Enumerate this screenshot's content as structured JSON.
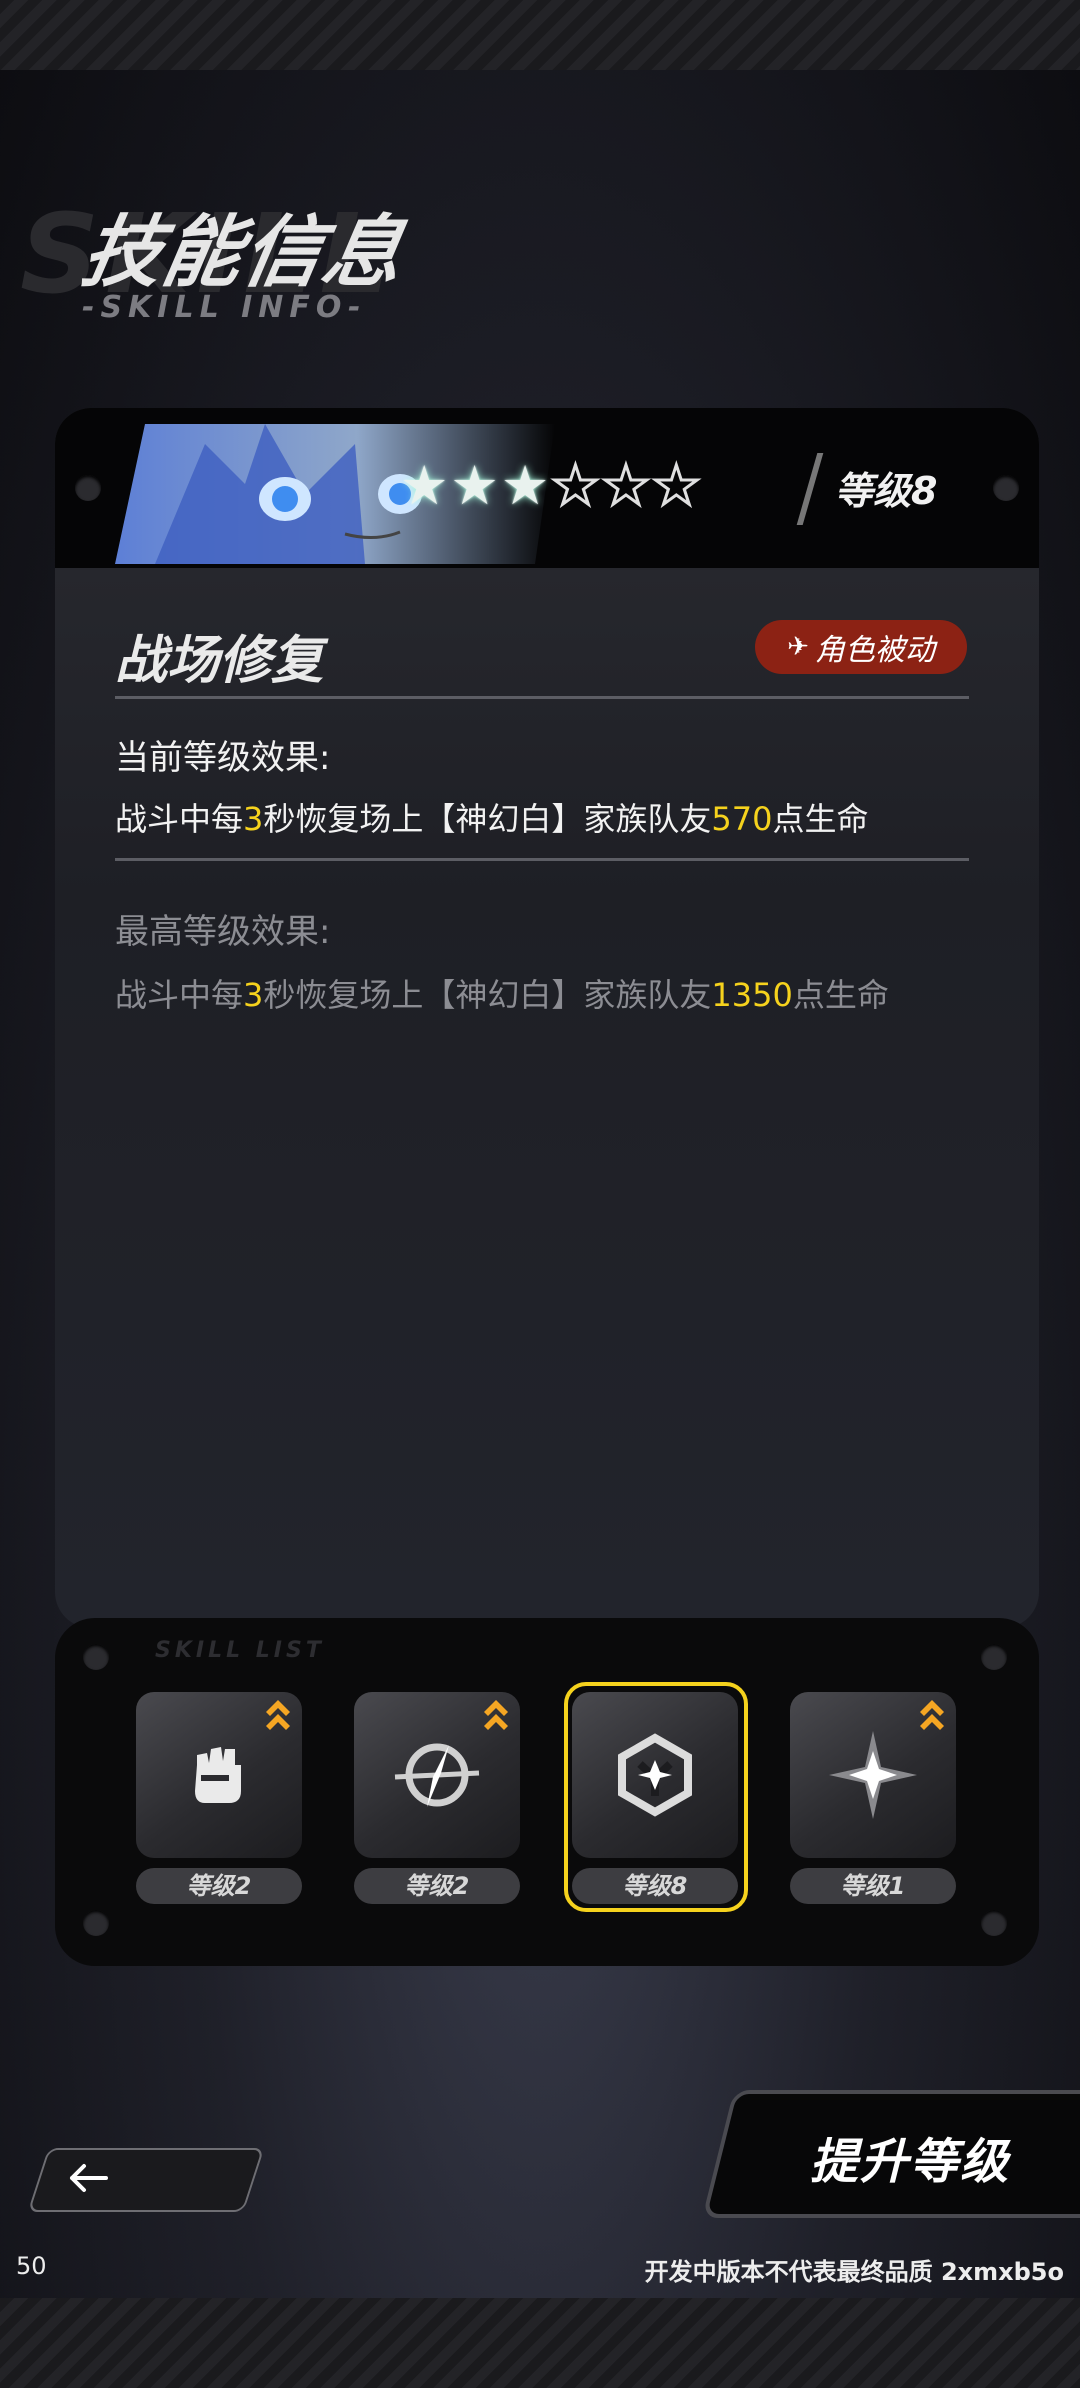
{
  "header": {
    "title": "技能信息",
    "subtitle": "-SKILL INFO-"
  },
  "card": {
    "level": "等级8",
    "stars_filled": 3,
    "stars_total": 6,
    "skill_name": "战场修复",
    "badge": "角色被动",
    "current": {
      "label": "当前等级效果:",
      "pre": "战斗中每",
      "n1": "3",
      "mid": "秒恢复场上【神幻白】家族队友",
      "n2": "570",
      "post": "点生命"
    },
    "max": {
      "label": "最高等级效果:",
      "pre": "战斗中每",
      "n1": "3",
      "mid": "秒恢复场上【神幻白】家族队友",
      "n2": "1350",
      "post": "点生命"
    }
  },
  "skills_panel": {
    "tag": "SKILL LIST",
    "slots": [
      {
        "icon": "fist-icon",
        "level": "等级2",
        "upgradable": true,
        "selected": false
      },
      {
        "icon": "compass-slash-icon",
        "level": "等级2",
        "upgradable": true,
        "selected": false
      },
      {
        "icon": "hex-cube-icon",
        "level": "等级8",
        "upgradable": false,
        "selected": true
      },
      {
        "icon": "four-point-star-icon",
        "level": "等级1",
        "upgradable": true,
        "selected": false
      }
    ]
  },
  "buttons": {
    "upgrade": "提升等级"
  },
  "footer": {
    "version": "50",
    "watermark": "开发中版本不代表最终品质 2xmxb5o"
  },
  "colors": {
    "highlight": "#f5d21d",
    "badge": "#8c2214",
    "upgrade_arrow": "#f5a623"
  }
}
